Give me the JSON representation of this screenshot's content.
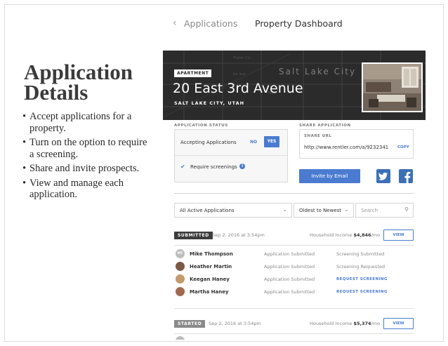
{
  "slide": {
    "title_line1": "Application",
    "title_line2": "Details",
    "bullets": [
      "Accept applications for a property.",
      "Turn on the option to require a screening.",
      "Share and invite prospects.",
      "View and manage each application."
    ]
  },
  "nav": {
    "back_label": "Applications",
    "current_label": "Property Dashboard"
  },
  "property": {
    "badge": "APARTMENT",
    "address": "20 East 3rd Avenue",
    "city_state": "SALT LAKE CITY, UTAH",
    "map_city": "Salt Lake City",
    "map_streets": [
      "Foster Ctr",
      "ter ave",
      "Mew"
    ]
  },
  "application_status": {
    "label": "APPLICATION STATUS",
    "accepting_label": "Accepting Applications",
    "no_label": "NO",
    "yes_label": "YES",
    "selected": "YES",
    "require_screenings_label": "Require screenings",
    "require_screenings_checked": true
  },
  "share": {
    "label": "SHARE APPLICATION",
    "url_label": "SHARE URL",
    "url": "http://www.rentler.com/a/9232341",
    "copy_label": "COPY",
    "invite_label": "Invite by Email",
    "social": [
      "twitter-icon",
      "facebook-icon"
    ]
  },
  "filters": {
    "status": "All Active Applications",
    "sort": "Oldest to Newest",
    "search_placeholder": "Search"
  },
  "groups": [
    {
      "status": "SUBMITTED",
      "date": "Sep 2, 2016 at 3:54pm",
      "income_label": "Household Income",
      "income_value": "$4,846",
      "income_unit": "/mo",
      "view_label": "VIEW",
      "applicants": [
        {
          "initials": "MT",
          "name": "Mike Thompson",
          "status": "Application Submitted",
          "screening": "Screening Submitted",
          "screening_is_link": false
        },
        {
          "initials": "",
          "name": "Heather Martin",
          "status": "Application Submitted",
          "screening": "Screening Requested",
          "screening_is_link": false
        },
        {
          "initials": "",
          "name": "Keegan Haney",
          "status": "Application Submitted",
          "screening": "REQUEST SCREENING",
          "screening_is_link": true
        },
        {
          "initials": "",
          "name": "Martha Haney",
          "status": "Application Submitted",
          "screening": "REQUEST SCREENING",
          "screening_is_link": true
        }
      ]
    },
    {
      "status": "STARTED",
      "date": "Sep 2, 2016 at 3:54pm",
      "income_label": "Household Income",
      "income_value": "$5,374",
      "income_unit": "/mo",
      "view_label": "VIEW"
    }
  ],
  "colors": {
    "accent": "#4a7bd0",
    "banner": "#2b2b2b"
  }
}
